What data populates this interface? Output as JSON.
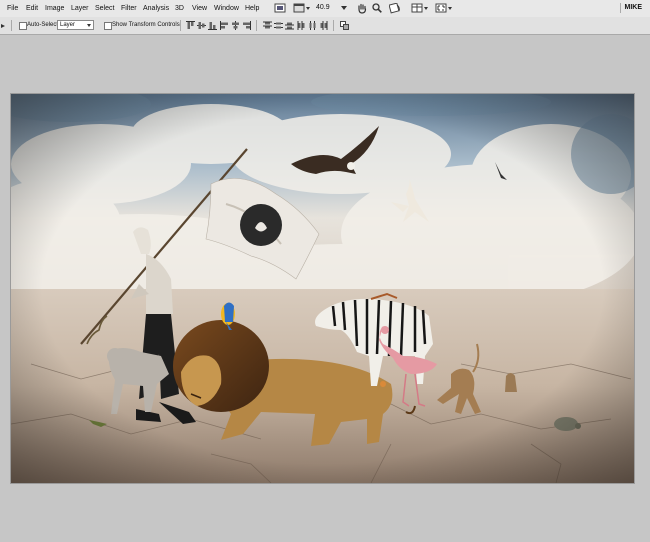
{
  "menubar": {
    "items": [
      {
        "label": "File"
      },
      {
        "label": "Edit"
      },
      {
        "label": "Image"
      },
      {
        "label": "Layer"
      },
      {
        "label": "Select"
      },
      {
        "label": "Filter"
      },
      {
        "label": "Analysis"
      },
      {
        "label": "3D"
      },
      {
        "label": "View"
      },
      {
        "label": "Window"
      },
      {
        "label": "Help"
      }
    ],
    "zoom": "40.9",
    "user": "MIKE"
  },
  "options": {
    "auto_select_label": "Auto-Select:",
    "auto_select_checked": false,
    "target": "Layer",
    "show_transform_label": "Show Transform Controls",
    "show_transform_checked": false
  },
  "colors": {
    "menubar_bg": "#e8e8e8",
    "optionsbar_bg": "#e1e1e1",
    "workspace_bg": "#c6c6c6"
  },
  "document": {
    "subjects": [
      "flag-bearer",
      "flag",
      "lion",
      "zebra",
      "flamingo",
      "monkey",
      "wolf",
      "parrot",
      "eagle",
      "white-bird",
      "meerkat",
      "tortoise",
      "lizard"
    ]
  }
}
